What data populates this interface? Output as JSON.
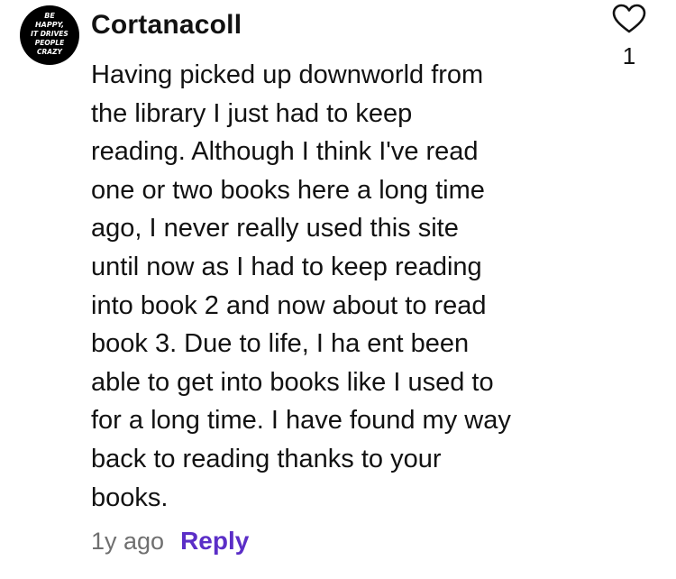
{
  "comment": {
    "avatar": {
      "lines": [
        "BE",
        "HAPPY,",
        "IT DRIVES",
        "PEOPLE",
        "CRAZY"
      ]
    },
    "username": "Cortanacoll",
    "body_lines": [
      "Having picked up downworld from",
      "the library I just had to keep",
      "reading. Although I think I've read",
      "one or two books here a long time",
      "ago, I never really used this site",
      "until now as I had to keep reading",
      "into book 2 and now about to read",
      "book 3. Due to life, I ha ent been",
      "able to get into books like I used to",
      "for a long time. I have found my way",
      "back to reading thanks to your",
      "books."
    ],
    "timestamp": "1y ago",
    "reply_label": "Reply",
    "like_icon": "heart-outline-icon",
    "like_count": "1"
  },
  "colors": {
    "text": "#121212",
    "muted": "#6f6f6f",
    "accent": "#5b2ec7",
    "avatar_bg": "#000000"
  }
}
